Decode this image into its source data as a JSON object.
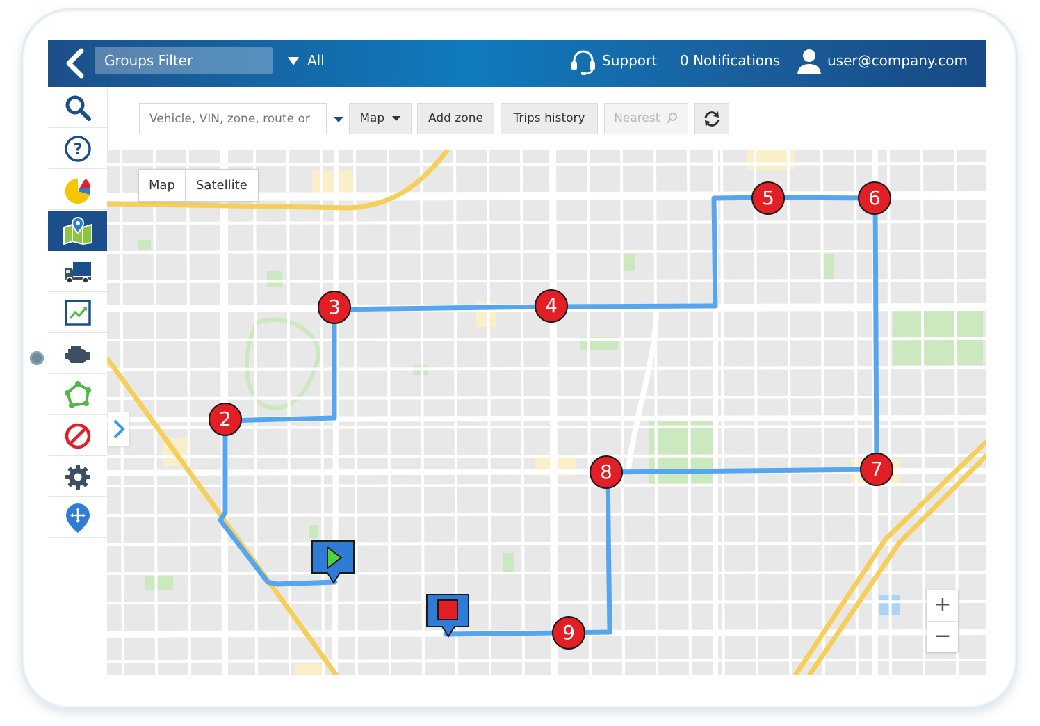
{
  "header": {
    "groups_filter": "Groups Filter",
    "all_label": "All",
    "support_label": "Support",
    "notifications_label": "0 Notifications",
    "user_label": "user@company.com"
  },
  "sidebar": {
    "items": [
      {
        "icon": "search-icon"
      },
      {
        "icon": "help-icon"
      },
      {
        "icon": "pie-chart-icon"
      },
      {
        "icon": "map-pin-icon",
        "active": true
      },
      {
        "icon": "truck-icon"
      },
      {
        "icon": "trend-chart-icon"
      },
      {
        "icon": "engine-icon"
      },
      {
        "icon": "geofence-icon"
      },
      {
        "icon": "block-icon"
      },
      {
        "icon": "gear-icon"
      },
      {
        "icon": "location-move-icon"
      }
    ]
  },
  "toolbar": {
    "search_placeholder": "Vehicle, VIN, zone, route or",
    "map_label": "Map",
    "add_zone_label": "Add zone",
    "trips_history_label": "Trips history",
    "nearest_label": "Nearest"
  },
  "map": {
    "type_toggle": {
      "map": "Map",
      "satellite": "Satellite"
    },
    "stops": [
      "2",
      "3",
      "4",
      "5",
      "6",
      "7",
      "8",
      "9"
    ],
    "route_color": "#55a6ee",
    "stop_color": "#e31e24",
    "start_marker": "start-play-icon",
    "end_marker": "end-stop-icon",
    "zoom": {
      "in": "+",
      "out": "−"
    }
  },
  "colors": {
    "header_start": "#1c4f8a",
    "header_mid": "#0f7bbd",
    "active_sidebar": "#1b4f8c"
  }
}
